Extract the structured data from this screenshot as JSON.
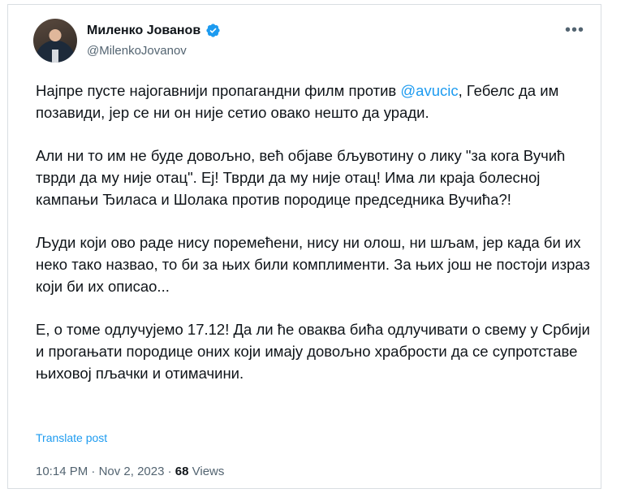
{
  "author": {
    "name": "Миленко Јованов",
    "handle": "@MilenkoJovanov",
    "verified": true,
    "avatar_icon": "profile-photo"
  },
  "more_label": "•••",
  "tweet": {
    "p1_before": "Најпре пусте најогавнији пропагандни филм против ",
    "p1_mention": "@avucic",
    "p1_after": ", Гебелс да им позавиди, јер се ни он није сетио овако нешто да уради.",
    "p2": "Али ни то им не буде довољно, већ објаве бљувотину о лику \"за кога Вучић тврди да му није отац\". Еј! Тврди да му није отац! Има ли краја болесној кампањи Ђиласа и Шолака против породице председника Вучића?!",
    "p3": "Људи који ово раде нису поремећени, нису ни олош, ни шљам, јер када би их неко тако назвао, то би за њих били комплименти. За њих још не постоји израз који би их описао...",
    "p4": "Е, о томе одлучујемо 17.12! Да ли ће оваква бића одлучивати о свему у Србији и прогањати породице оних који имају довољно храбрости да се супротставе њиховој пљачки и отимачини."
  },
  "translate_label": "Translate post",
  "meta": {
    "time": "10:14 PM",
    "sep1": " · ",
    "date": "Nov 2, 2023",
    "sep2": " · ",
    "views_count": "68",
    "views_label": " Views"
  },
  "colors": {
    "accent": "#1d9bf0",
    "muted": "#536471",
    "text": "#0f1419"
  }
}
